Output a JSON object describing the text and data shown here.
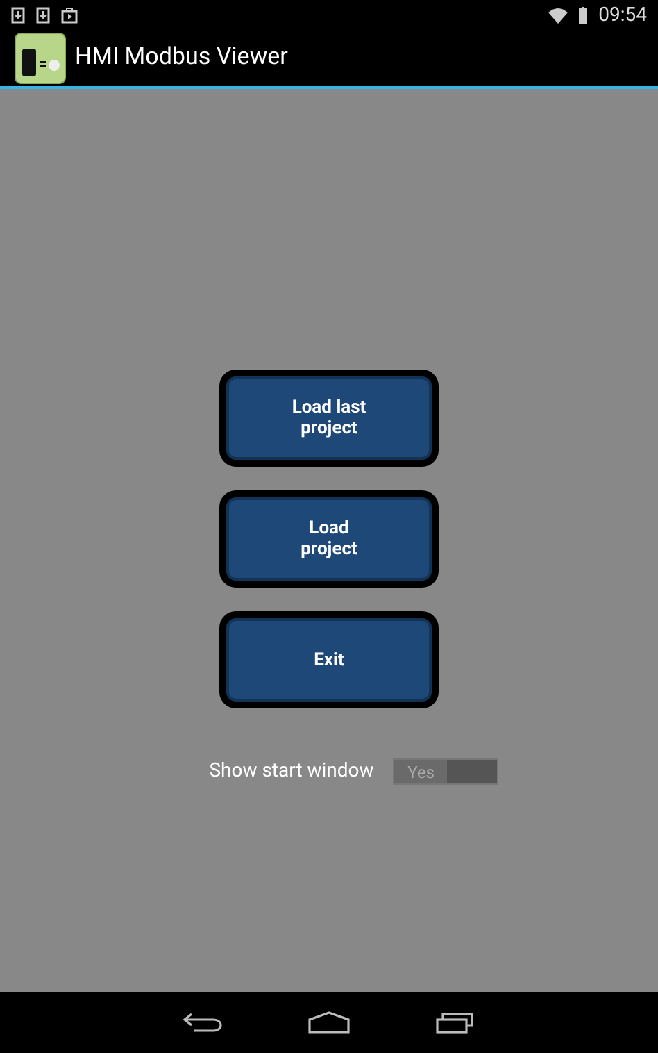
{
  "status_bar": {
    "time": "09:54"
  },
  "action_bar": {
    "title": "HMI Modbus Viewer"
  },
  "buttons": [
    {
      "label": "Load last project"
    },
    {
      "label": "Load project"
    },
    {
      "label": "Exit"
    }
  ],
  "start_window": {
    "label": "Show start window",
    "toggle_text": "Yes",
    "on": true
  }
}
